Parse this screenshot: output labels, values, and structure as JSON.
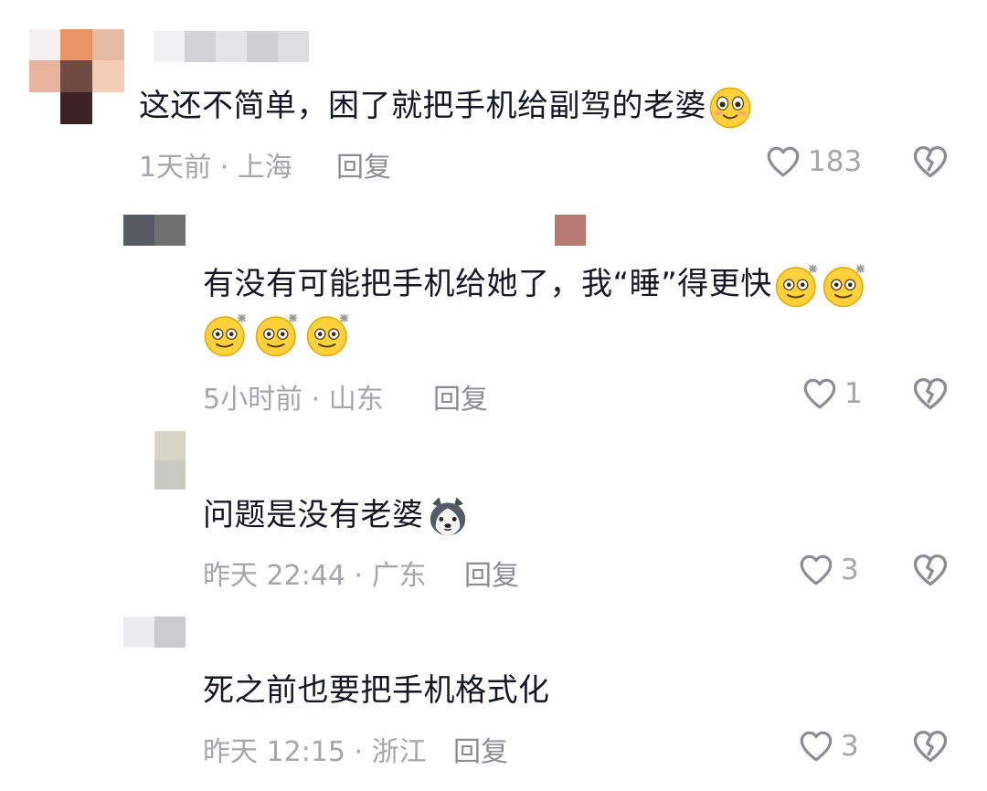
{
  "comments": [
    {
      "text": "这还不简单，困了就把手机给副驾的老婆",
      "time": "1天前",
      "location": "上海",
      "reply_label": "回复",
      "likes": "183",
      "emoji": "smile-face"
    },
    {
      "text": "有没有可能把手机给她了，我“睡”得更快",
      "time": "5小时前",
      "location": "山东",
      "reply_label": "回复",
      "likes": "1",
      "emoji": "dizzy-face"
    },
    {
      "text": "问题是没有老婆",
      "time": "昨天 22:44",
      "location": "广东",
      "reply_label": "回复",
      "likes": "3",
      "emoji": "husky-face"
    },
    {
      "text": "死之前也要把手机格式化",
      "time": "昨天 12:15",
      "location": "浙江",
      "reply_label": "回复",
      "likes": "3"
    }
  ],
  "separator": " · ",
  "icons": {
    "like": "heart-outline-icon",
    "dislike": "broken-heart-icon"
  },
  "colors": {
    "text": "#161823",
    "meta": "#a6a6aa",
    "icon": "#8c8c92"
  }
}
